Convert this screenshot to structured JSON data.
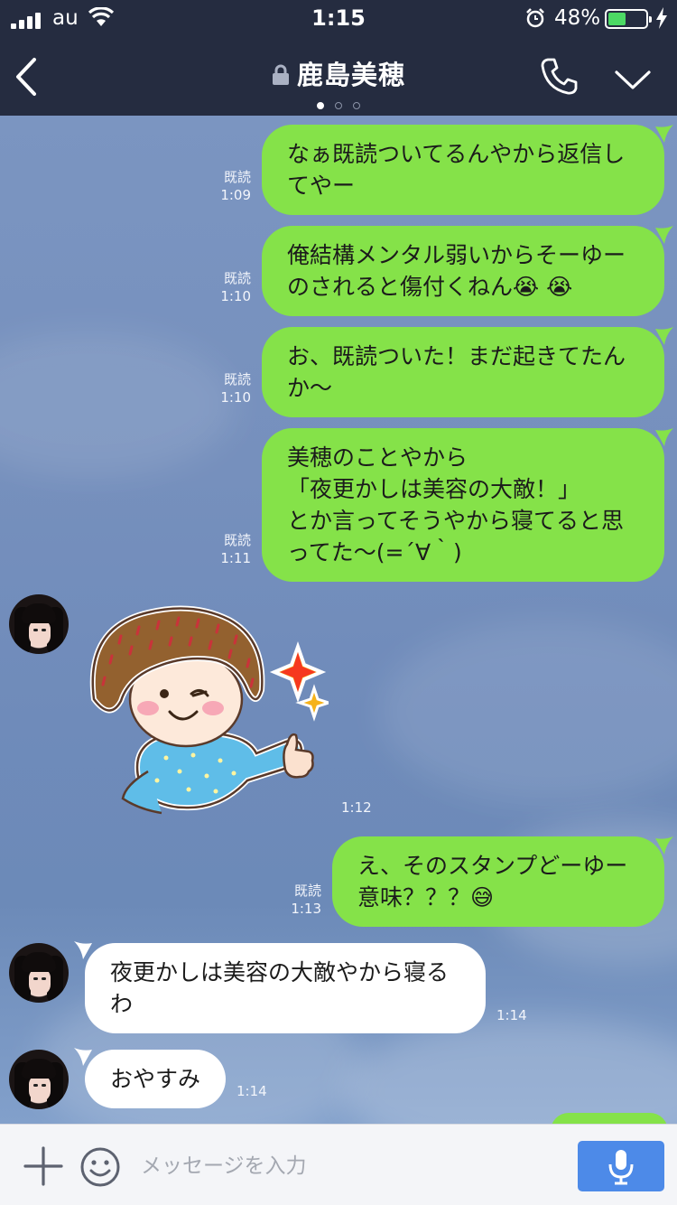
{
  "status_bar": {
    "carrier": "au",
    "time": "1:15",
    "battery_percent": "48%",
    "battery_level": 0.48,
    "icons": [
      "signal-icon",
      "wifi-icon",
      "alarm-icon",
      "battery-icon",
      "charging-icon"
    ]
  },
  "header": {
    "title": "鹿島美穂",
    "page_dots": 3,
    "active_dot": 0,
    "icons": [
      "back-chevron-icon",
      "lock-icon",
      "phone-icon",
      "chevron-down-icon"
    ]
  },
  "messages": [
    {
      "direction": "out",
      "read_label": "既読",
      "time": "1:09",
      "lines": [
        "なぁ既読ついてるんやから返信し",
        "てやー"
      ]
    },
    {
      "direction": "out",
      "read_label": "既読",
      "time": "1:10",
      "lines": [
        "俺結構メンタル弱いからそーゆー",
        "のされると傷付くねん😭 😭"
      ]
    },
    {
      "direction": "out",
      "read_label": "既読",
      "time": "1:10",
      "lines": [
        "お、既読ついた！まだ起きてたん",
        "か〜"
      ]
    },
    {
      "direction": "out",
      "read_label": "既読",
      "time": "1:11",
      "lines": [
        "美穂のことやから",
        "「夜更かしは美容の大敵！」",
        "とか言ってそうやから寝てると思",
        "ってた〜(=´∀｀)"
      ]
    },
    {
      "direction": "in",
      "type": "sticker",
      "sticker": "thumbs-up-girl-sticker",
      "time": "1:12"
    },
    {
      "direction": "out",
      "read_label": "既読",
      "time": "1:13",
      "lines": [
        "え、そのスタンプどーゆー",
        "意味？？？😅"
      ]
    },
    {
      "direction": "in",
      "time": "1:14",
      "lines": [
        "夜更かしは美容の大敵やから寝る",
        "わ"
      ]
    },
    {
      "direction": "in",
      "time": "1:14",
      "lines": [
        "おやすみ"
      ]
    }
  ],
  "input_bar": {
    "placeholder": "メッセージを入力",
    "value": "",
    "icons": [
      "plus-icon",
      "emoji-icon",
      "microphone-icon"
    ]
  },
  "colors": {
    "header_bg": "#252c40",
    "outgoing_bubble": "#85e249",
    "incoming_bubble": "#ffffff",
    "mic_button": "#4d8ae8",
    "battery_fill": "#4cd964"
  }
}
